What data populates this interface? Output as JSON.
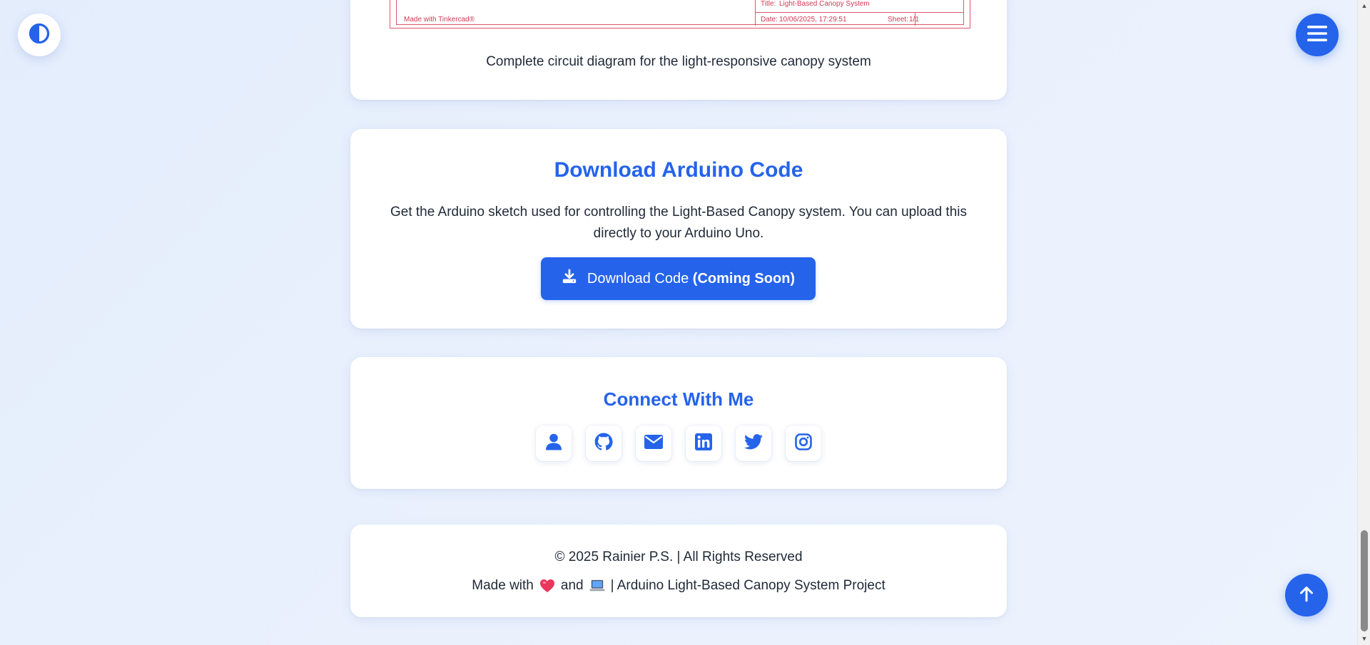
{
  "schematic": {
    "made_with": "Made with Tinkercad®",
    "title_label": "Title:",
    "title_value": "Light-Based Canopy System",
    "date_label": "Date:",
    "date_value": "10/06/2025, 17:29:51",
    "sheet_label": "Sheet:",
    "sheet_value": "1/1"
  },
  "diagram": {
    "caption": "Complete circuit diagram for the light-responsive canopy system"
  },
  "download": {
    "title": "Download Arduino Code",
    "description": "Get the Arduino sketch used for controlling the Light-Based Canopy system. You can upload this directly to your Arduino Uno.",
    "button_label": "Download Code",
    "button_status": "(Coming Soon)",
    "icon": "download-icon"
  },
  "connect": {
    "title": "Connect With Me",
    "links": [
      {
        "name": "portfolio",
        "icon": "user-icon"
      },
      {
        "name": "github",
        "icon": "github-icon"
      },
      {
        "name": "email",
        "icon": "envelope-icon"
      },
      {
        "name": "linkedin",
        "icon": "linkedin-icon"
      },
      {
        "name": "twitter",
        "icon": "twitter-icon"
      },
      {
        "name": "instagram",
        "icon": "instagram-icon"
      }
    ]
  },
  "footer": {
    "copyright": "© 2025 Rainier P.S. | All Rights Reserved",
    "made_with_prefix": "Made with",
    "and": "and",
    "project": "| Arduino Light-Based Canopy System Project"
  },
  "controls": {
    "theme_icon": "contrast-icon",
    "menu_icon": "hamburger-icon",
    "back_to_top_icon": "arrow-up-icon"
  },
  "colors": {
    "accent": "#2563eb",
    "background": "#e8f0fd",
    "schematic_red": "#d23a55",
    "heart": "#e8365d"
  }
}
